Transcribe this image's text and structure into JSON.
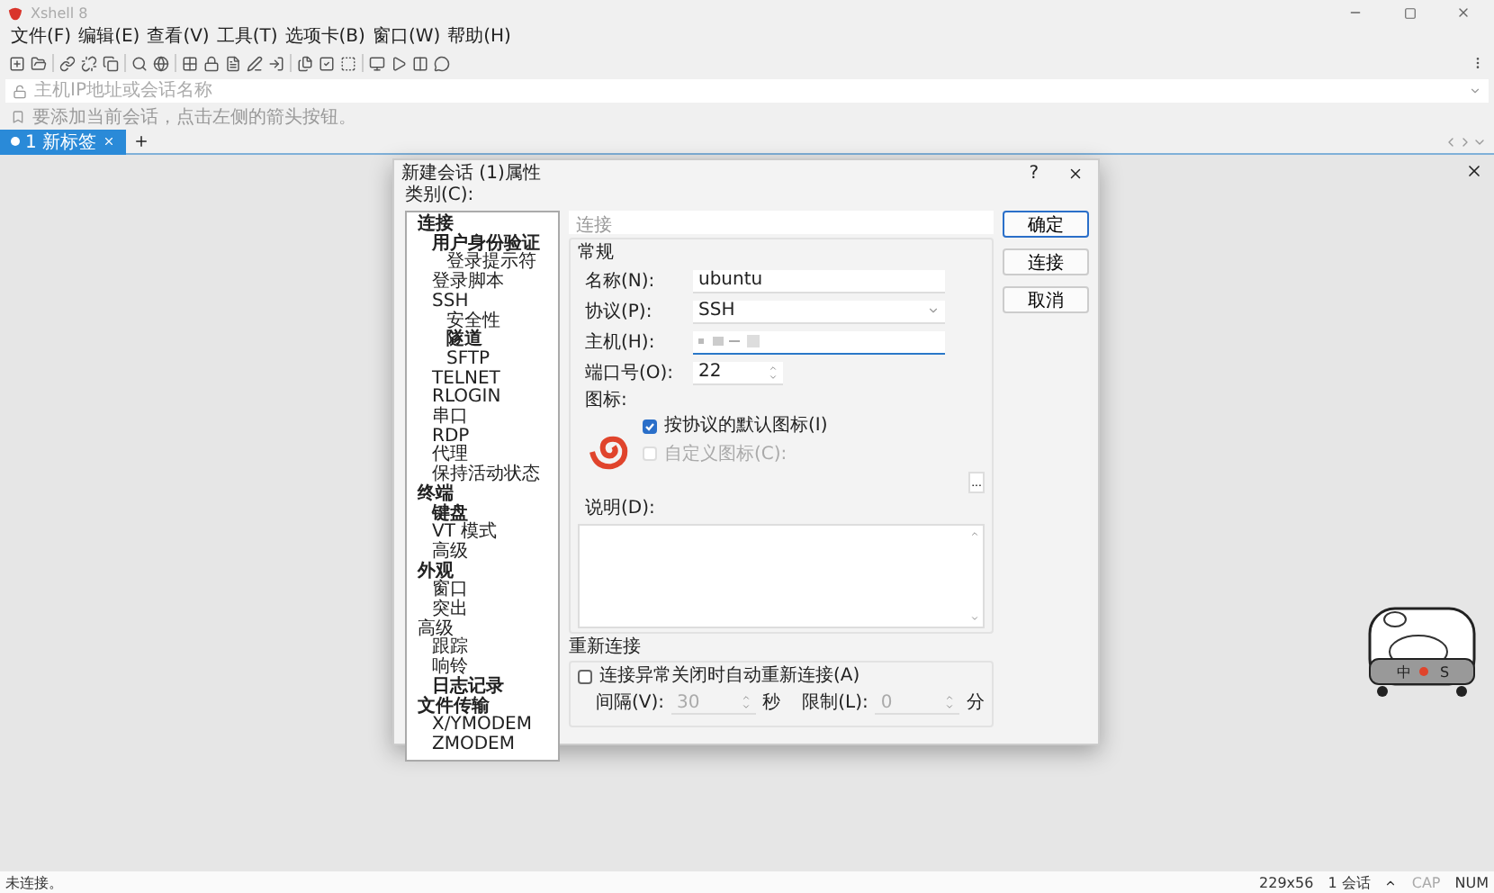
{
  "window": {
    "title": "Xshell 8"
  },
  "menu": [
    "文件(F)",
    "编辑(E)",
    "查看(V)",
    "工具(T)",
    "选项卡(B)",
    "窗口(W)",
    "帮助(H)"
  ],
  "address_bar": {
    "placeholder": "主机IP地址或会话名称"
  },
  "hint_bar": {
    "text": "要添加当前会话，点击左侧的箭头按钮。"
  },
  "tabs": [
    {
      "label": "1 新标签",
      "selected": true
    }
  ],
  "dialog": {
    "title": "新建会话 (1)属性",
    "category_label": "类别(C):",
    "tree": [
      {
        "label": "连接",
        "bold": true,
        "children": [
          {
            "label": "用户身份验证",
            "bold": true,
            "children": [
              {
                "label": "登录提示符",
                "bold": false
              }
            ]
          },
          {
            "label": "登录脚本",
            "bold": false
          },
          {
            "label": "SSH",
            "bold": false,
            "children": [
              {
                "label": "安全性",
                "bold": false
              },
              {
                "label": "隧道",
                "bold": true
              },
              {
                "label": "SFTP",
                "bold": false
              }
            ]
          },
          {
            "label": "TELNET",
            "bold": false
          },
          {
            "label": "RLOGIN",
            "bold": false
          },
          {
            "label": "串口",
            "bold": false
          },
          {
            "label": "RDP",
            "bold": false
          },
          {
            "label": "代理",
            "bold": false
          },
          {
            "label": "保持活动状态",
            "bold": false
          }
        ]
      },
      {
        "label": "终端",
        "bold": true,
        "children": [
          {
            "label": "键盘",
            "bold": true
          },
          {
            "label": "VT 模式",
            "bold": false
          },
          {
            "label": "高级",
            "bold": false
          }
        ]
      },
      {
        "label": "外观",
        "bold": true,
        "children": [
          {
            "label": "窗口",
            "bold": false
          },
          {
            "label": "突出",
            "bold": false
          }
        ]
      },
      {
        "label": "高级",
        "bold": false,
        "children": [
          {
            "label": "跟踪",
            "bold": false
          },
          {
            "label": "响铃",
            "bold": false
          },
          {
            "label": "日志记录",
            "bold": true
          }
        ]
      },
      {
        "label": "文件传输",
        "bold": true,
        "children": [
          {
            "label": "X/YMODEM",
            "bold": false
          },
          {
            "label": "ZMODEM",
            "bold": false
          }
        ]
      }
    ],
    "section_title": "连接",
    "general": {
      "title": "常规",
      "fields": [
        {
          "kind": "text",
          "label": "名称(N):",
          "value": "ubuntu"
        },
        {
          "kind": "select",
          "label": "协议(P):",
          "value": "SSH"
        },
        {
          "kind": "redacted",
          "label": "主机(H):"
        },
        {
          "kind": "spin",
          "label": "端口号(O):",
          "value": "22"
        }
      ],
      "icon_label": "图标:",
      "default_icon": {
        "label": "按协议的默认图标(I)",
        "checked": true
      },
      "custom_icon": {
        "label": "自定义图标(C):",
        "checked": false
      },
      "browse": "...",
      "description_label": "说明(D):"
    },
    "reconnect": {
      "title": "重新连接",
      "checkbox": {
        "label": "连接异常关闭时自动重新连接(A)",
        "checked": false
      },
      "interval_label": "间隔(V):",
      "interval": "30",
      "interval_unit": "秒",
      "limit_label": "限制(L):",
      "limit": "0",
      "limit_unit": "分"
    },
    "buttons": [
      "确定",
      "连接",
      "取消"
    ],
    "help": "?"
  },
  "widget": {
    "labels": [
      "中",
      "S"
    ]
  },
  "status_bar": {
    "left": "未连接。",
    "size": "229x56",
    "sessions": "1 会话",
    "caps": "CAP",
    "num": "NUM"
  }
}
